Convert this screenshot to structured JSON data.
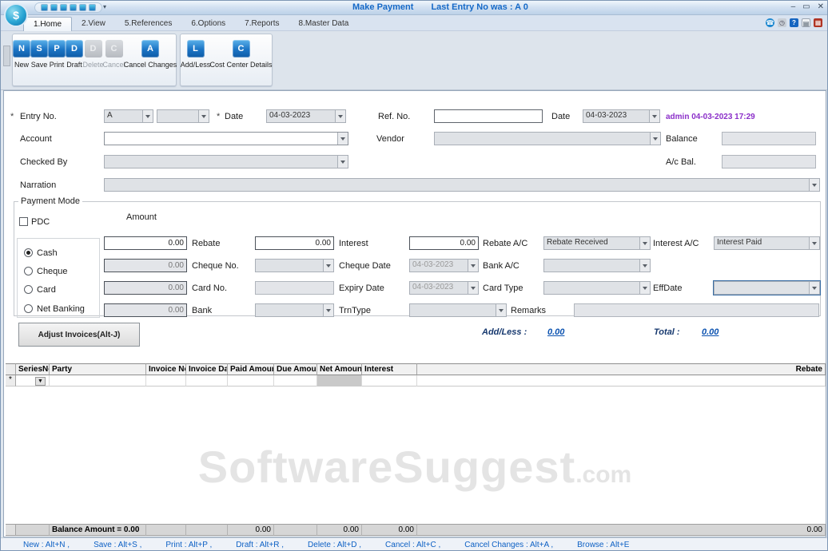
{
  "window": {
    "title": "Make Payment",
    "last_entry": "Last Entry No was : A 0",
    "logo_glyph": "$",
    "minimize": "–",
    "maximize": "▭",
    "close": "✕"
  },
  "tabs": [
    {
      "label": "1.Home"
    },
    {
      "label": "2.View"
    },
    {
      "label": "5.References"
    },
    {
      "label": "6.Options"
    },
    {
      "label": "7.Reports"
    },
    {
      "label": "8.Master Data"
    }
  ],
  "tab_icons": [
    {
      "name": "phone-icon",
      "glyph": "☎"
    },
    {
      "name": "clock-icon",
      "glyph": "◷"
    },
    {
      "name": "help-icon",
      "glyph": "?"
    },
    {
      "name": "note-icon",
      "glyph": "▤"
    },
    {
      "name": "label-icon",
      "glyph": "▦"
    }
  ],
  "ribbon": {
    "group1": [
      {
        "label": "New",
        "glyph": "N",
        "enabled": true
      },
      {
        "label": "Save",
        "glyph": "S",
        "enabled": true
      },
      {
        "label": "Print",
        "glyph": "P",
        "enabled": true
      },
      {
        "label": "Draft",
        "glyph": "D",
        "enabled": true
      },
      {
        "label": "Delete",
        "glyph": "D",
        "enabled": false
      },
      {
        "label": "Cancel",
        "glyph": "C",
        "enabled": false
      },
      {
        "label": "Cancel Changes",
        "glyph": "A",
        "enabled": true
      }
    ],
    "group2": [
      {
        "label": "Add/Less",
        "glyph": "L"
      },
      {
        "label": "Cost Center Details",
        "glyph": "C"
      }
    ]
  },
  "form": {
    "required_marker": "*",
    "entry_no_label": "Entry No.",
    "entry_series_value": "A",
    "entry_number_value": "",
    "date_label": "Date",
    "entry_date_value": "04-03-2023",
    "ref_no_label": "Ref. No.",
    "ref_no_value": "",
    "ref_date_label": "Date",
    "ref_date_value": "04-03-2023",
    "audit_stamp": "admin 04-03-2023 17:29",
    "account_label": "Account",
    "vendor_label": "Vendor",
    "balance_label": "Balance",
    "checked_by_label": "Checked By",
    "ac_bal_label": "A/c Bal.",
    "narration_label": "Narration"
  },
  "payment": {
    "legend": "Payment Mode",
    "pdc_label": "PDC",
    "amount_header": "Amount",
    "modes": [
      {
        "label": "Cash",
        "selected": true
      },
      {
        "label": "Cheque",
        "selected": false
      },
      {
        "label": "Card",
        "selected": false
      },
      {
        "label": "Net Banking",
        "selected": false
      }
    ],
    "cash_amount": "0.00",
    "cheque_amount": "0.00",
    "card_amount": "0.00",
    "netbanking_amount": "0.00",
    "rebate_label": "Rebate",
    "rebate_value": "0.00",
    "interest_label": "Interest",
    "interest_value": "0.00",
    "rebate_ac_label": "Rebate A/C",
    "rebate_ac_value": "Rebate Received",
    "interest_ac_label": "Interest A/C",
    "interest_ac_value": "Interest Paid",
    "cheque_no_label": "Cheque No.",
    "cheque_date_label": "Cheque Date",
    "cheque_date_value": "04-03-2023",
    "bank_ac_label": "Bank A/C",
    "card_no_label": "Card No.",
    "expiry_date_label": "Expiry Date",
    "expiry_date_value": "04-03-2023",
    "card_type_label": "Card Type",
    "effdate_label": "EffDate",
    "bank_label": "Bank",
    "trntype_label": "TrnType",
    "remarks_label": "Remarks"
  },
  "adjust": {
    "button_label": "Adjust Invoices(Alt-J)",
    "addless_label": "Add/Less :",
    "addless_value": "0.00",
    "total_label": "Total :",
    "total_value": "0.00"
  },
  "grid": {
    "columns": [
      "SeriesNo",
      "Party",
      "Invoice No",
      "Invoice Date",
      "Paid Amount",
      "Due Amount",
      "Net Amount",
      "Interest",
      "Rebate"
    ],
    "new_row_marker": "*",
    "dropdown_glyph": "▼",
    "balance_label": "Balance Amount = 0.00",
    "totals": {
      "paid": "0.00",
      "net": "0.00",
      "interest": "0.00",
      "rebate": "0.00"
    }
  },
  "statusbar": {
    "shortcuts": [
      "New : Alt+N ,",
      "Save : Alt+S ,",
      "Print : Alt+P ,",
      "Draft : Alt+R ,",
      "Delete : Alt+D ,",
      "Cancel : Alt+C ,",
      "Cancel Changes : Alt+A ,",
      "Browse : Alt+E"
    ]
  },
  "watermark": {
    "main": "SoftwareSuggest",
    "suffix": ".com"
  },
  "colors": {
    "accent_blue": "#1569c7",
    "audit_purple": "#8b2fc9",
    "link_blue": "#0b52b0",
    "status_blue": "#0d60c4"
  }
}
